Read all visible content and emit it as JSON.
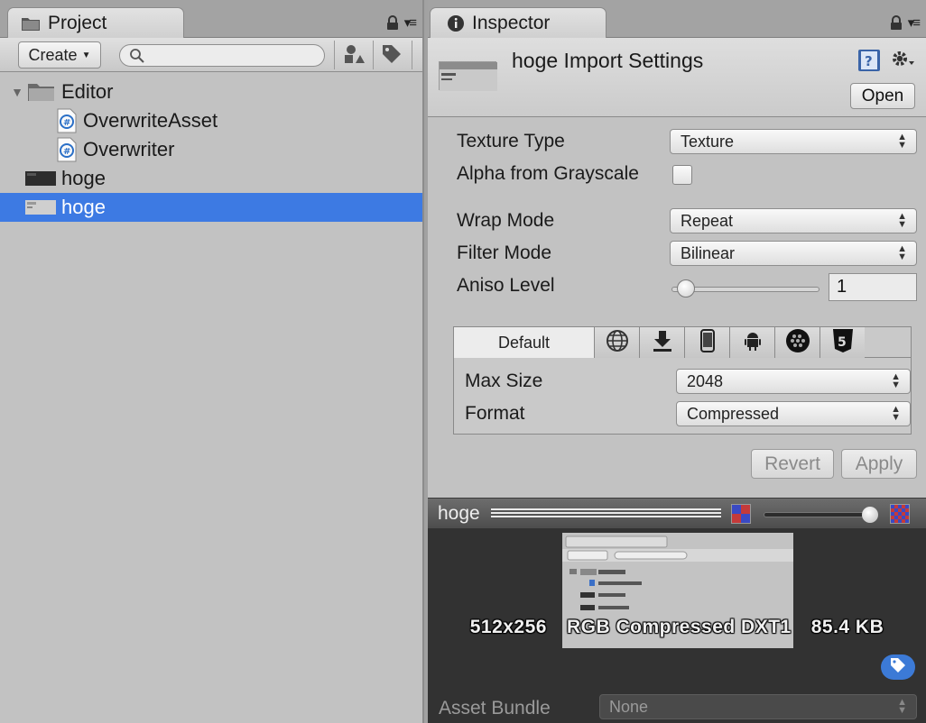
{
  "project": {
    "tab_title": "Project",
    "create_label": "Create",
    "search_placeholder": "",
    "tree": [
      {
        "label": "Editor",
        "type": "folder",
        "depth": 0,
        "expanded": true
      },
      {
        "label": "OverwriteAsset",
        "type": "cs-script",
        "depth": 1
      },
      {
        "label": "Overwriter",
        "type": "cs-script",
        "depth": 1
      },
      {
        "label": "hoge",
        "type": "texture",
        "depth": 0
      },
      {
        "label": "hoge",
        "type": "texture",
        "depth": 0,
        "selected": true
      }
    ]
  },
  "inspector": {
    "tab_title": "Inspector",
    "header_title": "hoge Import Settings",
    "open_label": "Open",
    "texture_type_label": "Texture Type",
    "texture_type_value": "Texture",
    "alpha_label": "Alpha from Grayscale",
    "wrap_label": "Wrap Mode",
    "wrap_value": "Repeat",
    "filter_label": "Filter Mode",
    "filter_value": "Bilinear",
    "aniso_label": "Aniso Level",
    "aniso_value": "1",
    "platform": {
      "default_tab": "Default",
      "tab_icons": [
        "globe-icon",
        "download-icon",
        "phone-icon",
        "android-icon",
        "blackberry-icon",
        "html5-icon"
      ],
      "max_size_label": "Max Size",
      "max_size_value": "2048",
      "format_label": "Format",
      "format_value": "Compressed"
    },
    "revert_label": "Revert",
    "apply_label": "Apply",
    "preview": {
      "title": "hoge",
      "dimensions": "512x256",
      "format": "RGB Compressed DXT1",
      "size": "85.4 KB"
    },
    "asset_bundle_label": "Asset Bundle",
    "asset_bundle_value": "None"
  },
  "colors": {
    "selection": "#3d7ae3",
    "panel_bg": "#c2c2c2",
    "preview_bg": "#323232"
  }
}
